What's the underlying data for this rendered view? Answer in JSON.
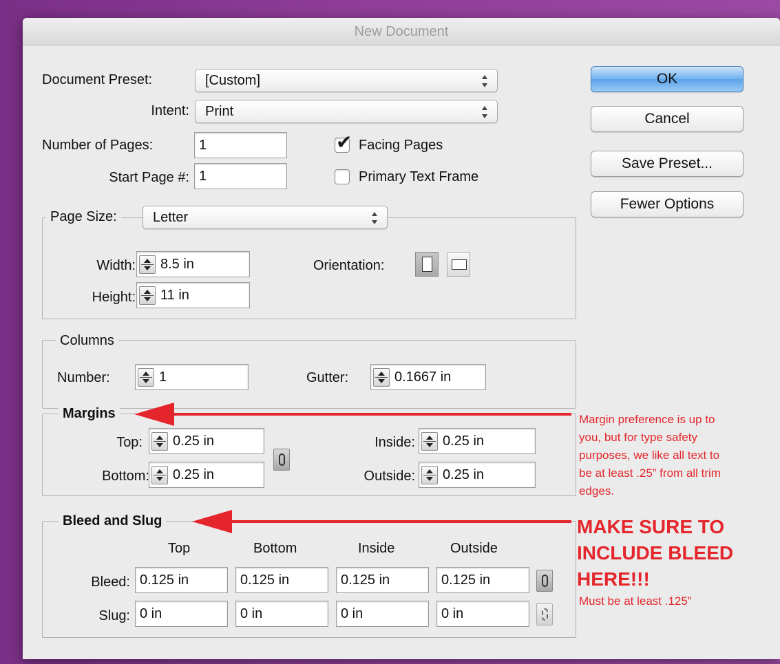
{
  "window": {
    "title": "New Document"
  },
  "preset": {
    "label": "Document Preset:",
    "value": "[Custom]"
  },
  "intent": {
    "label": "Intent:",
    "value": "Print"
  },
  "pages": {
    "label": "Number of Pages:",
    "value": "1"
  },
  "start_page": {
    "label": "Start Page #:",
    "value": "1"
  },
  "facing_pages": {
    "label": "Facing Pages",
    "checked": true,
    "mark": "✔"
  },
  "primary_text_frame": {
    "label": "Primary Text Frame",
    "checked": false
  },
  "buttons": {
    "ok": "OK",
    "cancel": "Cancel",
    "save_preset": "Save Preset...",
    "fewer_options": "Fewer Options"
  },
  "page_size": {
    "label": "Page Size:",
    "value": "Letter",
    "width_label": "Width:",
    "width": "8.5 in",
    "height_label": "Height:",
    "height": "11 in",
    "orientation_label": "Orientation:",
    "orientation_selected": "portrait"
  },
  "columns": {
    "legend": "Columns",
    "number_label": "Number:",
    "number": "1",
    "gutter_label": "Gutter:",
    "gutter": "0.1667 in"
  },
  "margins": {
    "legend": "Margins",
    "top_label": "Top:",
    "top": "0.25 in",
    "bottom_label": "Bottom:",
    "bottom": "0.25 in",
    "inside_label": "Inside:",
    "inside": "0.25 in",
    "outside_label": "Outside:",
    "outside": "0.25 in"
  },
  "bleed_slug": {
    "legend": "Bleed and Slug",
    "headers": [
      "Top",
      "Bottom",
      "Inside",
      "Outside"
    ],
    "bleed_label": "Bleed:",
    "bleed": [
      "0.125 in",
      "0.125 in",
      "0.125 in",
      "0.125 in"
    ],
    "slug_label": "Slug:",
    "slug": [
      "0 in",
      "0 in",
      "0 in",
      "0 in"
    ]
  },
  "annotations": {
    "margin_note": [
      "Margin preference is up to",
      "you, but for type safety",
      "purposes, we like all text to",
      "be at least .25” from all trim",
      "edges."
    ],
    "bleed_note": [
      "MAKE SURE TO",
      "INCLUDE BLEED",
      "HERE!!!"
    ],
    "bleed_subnote": "Must be at least .125”",
    "accent_color": "#e4262c"
  }
}
